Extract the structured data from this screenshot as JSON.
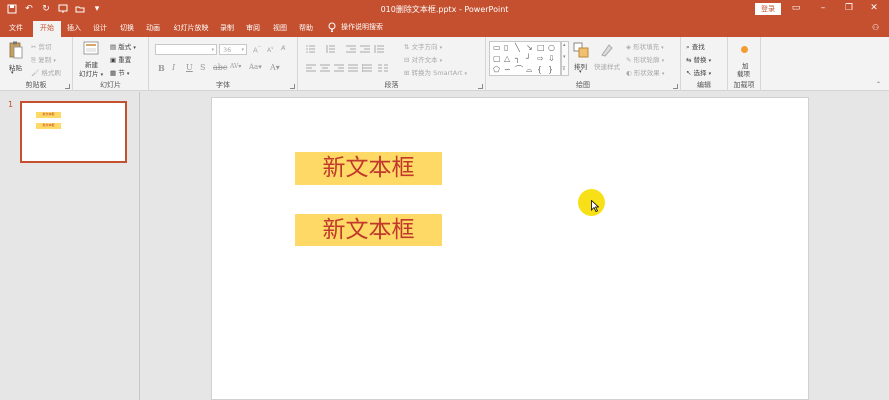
{
  "window": {
    "title": "010删除文本框.pptx - PowerPoint",
    "login_label": "登录"
  },
  "tabs": [
    {
      "label": "文件"
    },
    {
      "label": "开始"
    },
    {
      "label": "插入"
    },
    {
      "label": "设计"
    },
    {
      "label": "切换"
    },
    {
      "label": "动画"
    },
    {
      "label": "幻灯片放映"
    },
    {
      "label": "录制"
    },
    {
      "label": "审阅"
    },
    {
      "label": "视图"
    },
    {
      "label": "帮助"
    }
  ],
  "tellme": {
    "label": "操作说明搜索"
  },
  "ribbon": {
    "clipboard": {
      "label": "剪贴板",
      "paste": "粘贴",
      "cut": "剪切",
      "copy": "复制",
      "format_painter": "格式刷"
    },
    "slides": {
      "label": "幻灯片",
      "new_slide_1": "新建",
      "new_slide_2": "幻灯片",
      "layout": "版式",
      "reset": "重置",
      "section": "节"
    },
    "font": {
      "label": "字体",
      "size": "36"
    },
    "paragraph": {
      "label": "段落",
      "text_direction": "文字方向",
      "align_text": "对齐文本",
      "smartart": "转换为 SmartArt"
    },
    "drawing": {
      "label": "绘图",
      "arrange": "排列",
      "quick_styles": "快速样式",
      "shape_fill": "形状填充",
      "shape_outline": "形状轮廓",
      "shape_effects": "形状效果"
    },
    "editing": {
      "label": "编辑",
      "find": "查找",
      "replace": "替换",
      "select": "选择"
    },
    "addins": {
      "label": "加载项",
      "btn_1": "加",
      "btn_2": "载项"
    }
  },
  "thumbnails": [
    {
      "number": "1",
      "box1": "新文本框",
      "box2": "新文本框"
    }
  ],
  "slide": {
    "textbox1": "新文本框",
    "textbox2": "新文本框"
  },
  "colors": {
    "accent": "#c4502f",
    "textbox_fill": "#ffd966",
    "textbox_text": "#c0392b",
    "cursor_highlight": "#f7e017"
  }
}
